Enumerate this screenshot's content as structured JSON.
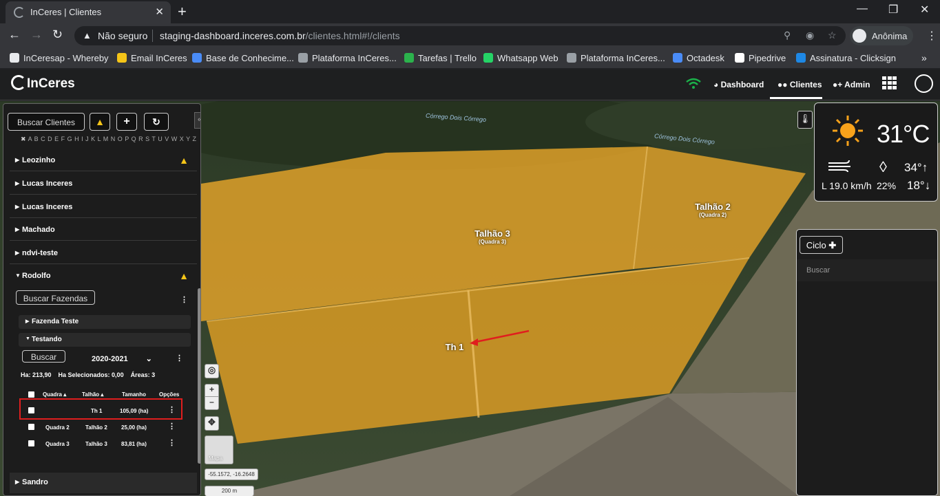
{
  "browser": {
    "tab_title": "InCeres | Clientes",
    "tab_close": "✕",
    "new_tab": "+",
    "window_controls": [
      "—",
      "❐",
      "✕"
    ],
    "security_label": "Não seguro",
    "url_host": "staging-dashboard.inceres.com.br",
    "url_path": "/clientes.html#!/clients",
    "profile_label": "Anônima",
    "bookmarks": [
      {
        "label": "InCeresap - Whereby",
        "color": "#e8eaed"
      },
      {
        "label": "Email InCeres",
        "color": "#f5c518"
      },
      {
        "label": "Base de Conhecime...",
        "color": "#4a8cf7"
      },
      {
        "label": "Plataforma InCeres...",
        "color": "#9aa0a6"
      },
      {
        "label": "Tarefas | Trello",
        "color": "#2bb24c"
      },
      {
        "label": "Whatsapp Web",
        "color": "#25d366"
      },
      {
        "label": "Plataforma InCeres...",
        "color": "#9aa0a6"
      },
      {
        "label": "Octadesk",
        "color": "#4a8cf7"
      },
      {
        "label": "Pipedrive",
        "color": "#ffffff"
      },
      {
        "label": "Assinatura - Clicksign",
        "color": "#1e88e5"
      }
    ],
    "bookmarks_more": "»"
  },
  "app": {
    "logo": "InCeres",
    "nav": {
      "dashboard": "Dashboard",
      "clientes": "Clientes",
      "admin": "Admin"
    },
    "accent": "#1bb14a"
  },
  "sidebar": {
    "search_button": "Buscar Clientes",
    "alphabet_clear": "✖",
    "alphabet": "A B C D E F G H I J K L M N O P Q R S T U V W X Y Z",
    "clients": [
      {
        "name": "Leozinho",
        "warning": true
      },
      {
        "name": "Lucas Inceres",
        "warning": false
      },
      {
        "name": "Lucas Inceres",
        "warning": false
      },
      {
        "name": "Machado",
        "warning": false
      },
      {
        "name": "ndvi-teste",
        "warning": false
      },
      {
        "name": "Rodolfo",
        "warning": true,
        "expanded": true
      }
    ],
    "farm_search": "Buscar Fazendas",
    "farms": [
      {
        "name": "Fazenda Teste",
        "expanded": false
      },
      {
        "name": "Testando",
        "expanded": true
      }
    ],
    "buscar": "Buscar",
    "season": "2020-2021",
    "stats": "Ha: 213,90    Ha Selecionados: 0,00    Áreas: 3",
    "table": {
      "headers": [
        "Quadra",
        "Talhão",
        "Tamanho",
        "Opções"
      ],
      "rows": [
        {
          "quadra": "",
          "talhao": "Th 1",
          "tamanho": "105,09 (ha)",
          "highlight": true
        },
        {
          "quadra": "Quadra 2",
          "talhao": "Talhão 2",
          "tamanho": "25,00 (ha)",
          "highlight": false
        },
        {
          "quadra": "Quadra 3",
          "talhao": "Talhão 3",
          "tamanho": "83,81 (ha)",
          "highlight": false
        }
      ]
    },
    "last_client": "Sandro"
  },
  "map": {
    "stream_label": "Córrego Dois Córrego",
    "fields": [
      {
        "name": "Talhão 3",
        "sub": "(Quadra 3)"
      },
      {
        "name": "Talhão 2",
        "sub": "(Quadra 2)"
      },
      {
        "name": "Th 1",
        "sub": ""
      }
    ],
    "field_color": "#e6a52a",
    "map_type": "Mapa",
    "coords": "-55.1572, -16.2648",
    "scale": "200 m"
  },
  "weather": {
    "temp": "31°C",
    "max": "34°",
    "min": "18°",
    "humidity": "22%",
    "wind": "L 19.0 km/h"
  },
  "ciclo": {
    "button": "Ciclo",
    "search": "Buscar"
  }
}
